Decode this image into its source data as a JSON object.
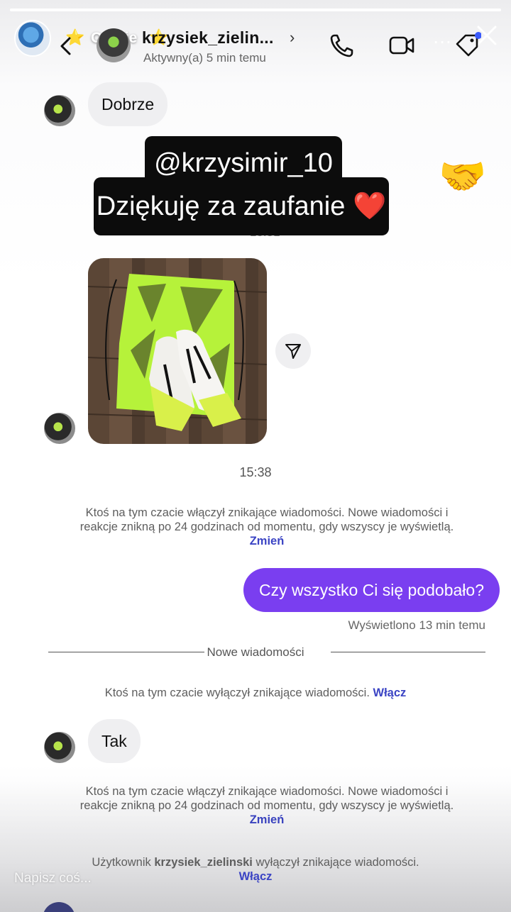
{
  "story": {
    "progress_fraction": 1.0,
    "title_prefix": "Opinie",
    "star": "⭐",
    "more_icon": "…"
  },
  "header": {
    "name": "krzysiek_zielin...",
    "chevron": "›",
    "status": "Aktywny(a) 5 min temu",
    "icons": [
      "back-arrow-icon",
      "phone-icon",
      "video-icon",
      "tag-icon",
      "close-icon"
    ]
  },
  "messages": {
    "m1_text": "Dobrze",
    "sticker_handle": "@krzysimir_10",
    "sticker_thanks": "Dziękuję za zaufanie ❤️",
    "time_hidden": "15:31",
    "handshake": "🤝",
    "time1": "15:38",
    "sys1_text": "Ktoś na tym czacie włączył znikające wiadomości. Nowe wiadomości i reakcje znikną po 24 godzinach od momentu, gdy wszyscy je wyświetlą.",
    "sys1_link": "Zmień",
    "out_text": "Czy wszystko Ci się podobało?",
    "seen": "Wyświetlono 13 min temu",
    "new_messages": "Nowe wiadomości",
    "sys2_text": "Ktoś na tym czacie wyłączył znikające wiadomości.",
    "sys2_link": "Włącz",
    "m2_text": "Tak",
    "sys3_text": "Ktoś na tym czacie włączył znikające wiadomości. Nowe wiadomości i reakcje znikną po 24 godzinach od momentu, gdy wszyscy je wyświetlą.",
    "sys3_link": "Zmień",
    "sys4_prefix": "Użytkownik",
    "sys4_user": "krzysiek_zielinski",
    "sys4_suffix": "wyłączył znikające wiadomości.",
    "sys4_link": "Włącz"
  },
  "composer": {
    "placeholder": "Napisz coś..."
  },
  "colors": {
    "accent": "#7a3ef0",
    "link": "#3b44c4"
  }
}
